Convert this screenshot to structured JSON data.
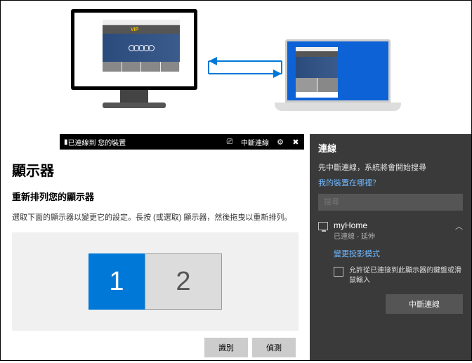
{
  "illustration": {
    "vip_label": "VIP"
  },
  "titlebar": {
    "text": "已連線到 您的裝置",
    "disconnect_label": "中斷連線"
  },
  "settings": {
    "heading": "顯示器",
    "subheading": "重新排列您的顯示器",
    "description": "選取下面的顯示器以變更它的設定。長按 (或選取) 顯示器，然後拖曳以重新排列。",
    "display1": "1",
    "display2": "2",
    "identify_btn": "識別",
    "detect_btn": "偵測"
  },
  "connect": {
    "title": "連線",
    "subtitle": "先中斷連線，系統將會開始搜尋",
    "where_link": "我的裝置在哪裡？",
    "search_placeholder": "搜尋",
    "device_name": "myHome",
    "device_status": "已連線 - 延伸",
    "change_mode": "變更投影模式",
    "allow_input_label": "允許從已連接到此顯示器的鍵盤或滑鼠輸入",
    "disconnect_btn": "中斷連線"
  }
}
